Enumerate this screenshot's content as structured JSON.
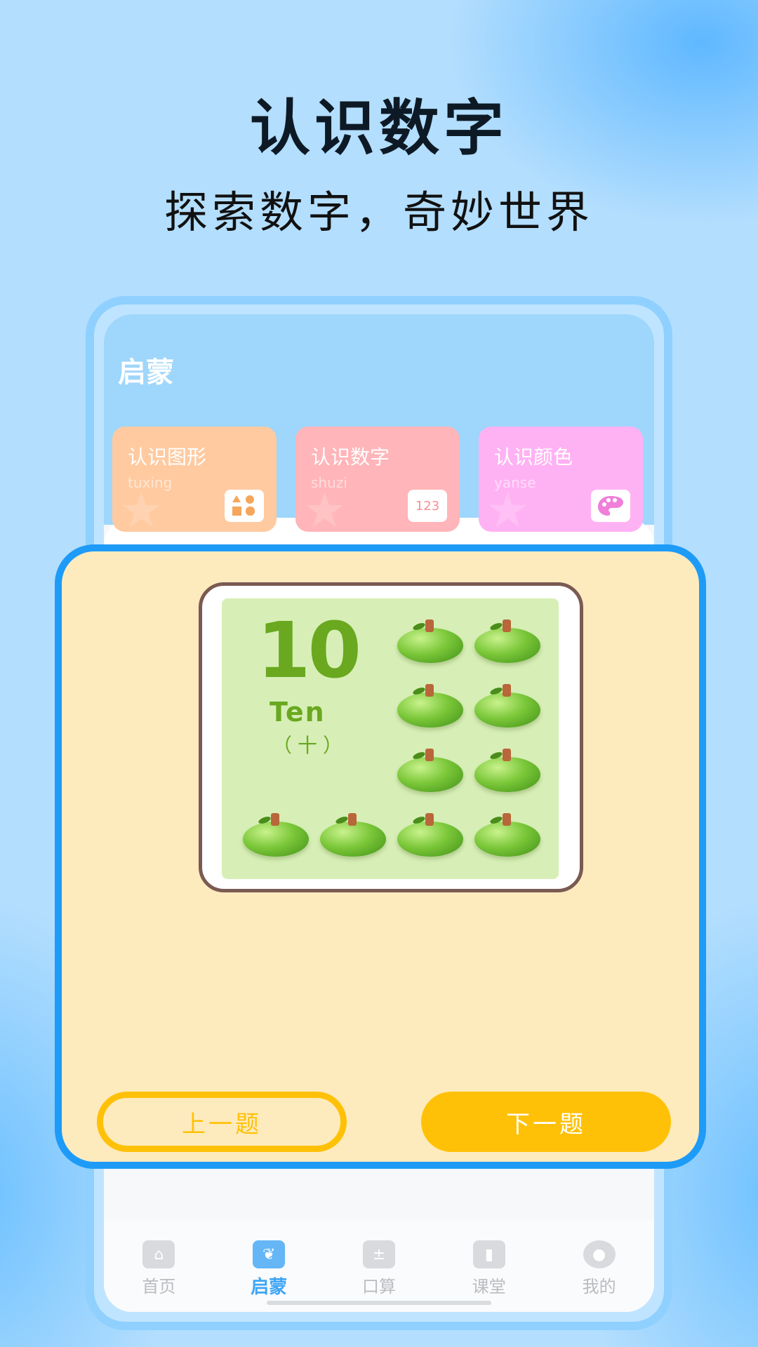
{
  "promo": {
    "headline": "认识数字",
    "subline": "探索数字，奇妙世界"
  },
  "app": {
    "section_title": "启蒙",
    "categories": [
      {
        "title": "认识图形",
        "subtitle": "tuxing",
        "icon": "shapes-icon",
        "icon_text": "",
        "color": "#ffcaa0"
      },
      {
        "title": "认识数字",
        "subtitle": "shuzi",
        "icon": "numbers-icon",
        "icon_text": "123",
        "color": "#ffb5b9"
      },
      {
        "title": "认识颜色",
        "subtitle": "yanse",
        "icon": "palette-icon",
        "icon_text": "",
        "color": "#ffb2f3"
      }
    ],
    "tabs": [
      {
        "label": "首页",
        "icon": "home-icon",
        "active": false
      },
      {
        "label": "启蒙",
        "icon": "sprout-icon",
        "active": true
      },
      {
        "label": "口算",
        "icon": "calculator-icon",
        "active": false
      },
      {
        "label": "课堂",
        "icon": "book-icon",
        "active": false
      },
      {
        "label": "我的",
        "icon": "user-icon",
        "active": false
      }
    ]
  },
  "flashcard": {
    "number": "10",
    "word": "Ten",
    "chinese": "（十）",
    "apple_count": 10
  },
  "buttons": {
    "prev": "上一题",
    "next": "下一题"
  },
  "colors": {
    "modal_border": "#1e9bf7",
    "modal_bg": "#fdebbe",
    "button_yellow": "#ffc107",
    "active_tab": "#3ea5f6"
  }
}
